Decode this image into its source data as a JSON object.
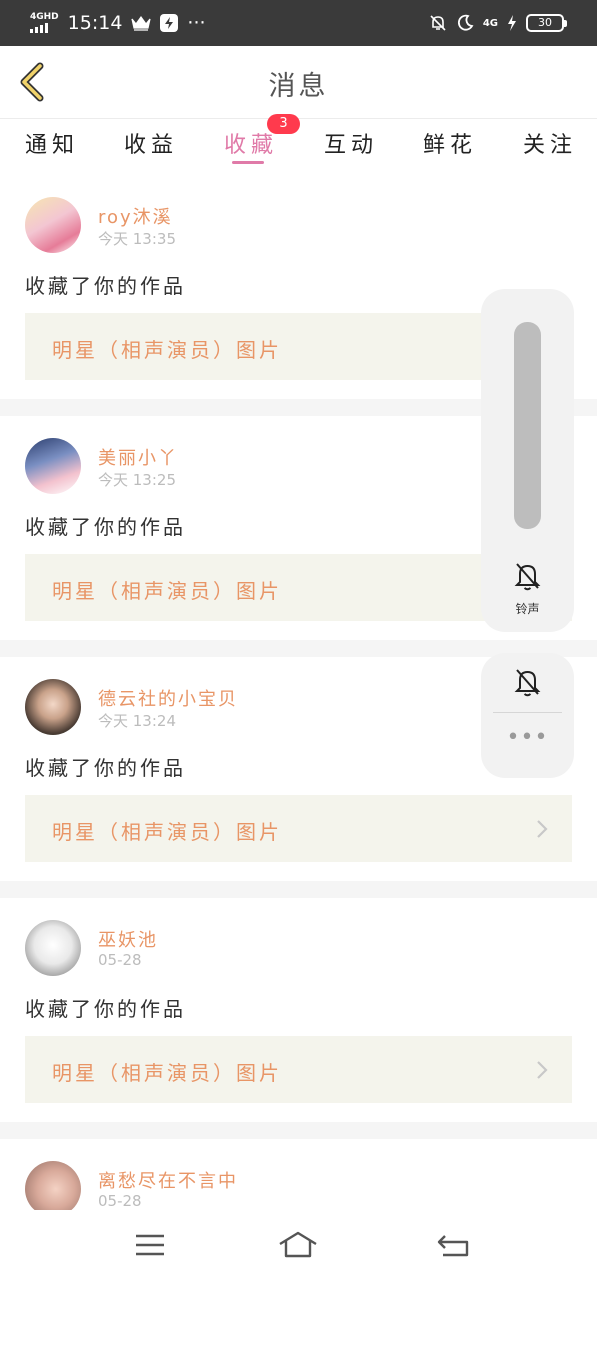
{
  "status_bar": {
    "network": "4GHD",
    "time": "15:14",
    "more": "···",
    "net2": "4G",
    "battery": "30"
  },
  "header": {
    "title": "消息"
  },
  "tabs": [
    {
      "label": "通知"
    },
    {
      "label": "收益"
    },
    {
      "label": "收藏",
      "active": true,
      "badge": "3"
    },
    {
      "label": "互动"
    },
    {
      "label": "鲜花"
    },
    {
      "label": "关注"
    }
  ],
  "items": [
    {
      "user": "roy沐溪",
      "time": "今天 13:35",
      "action": "收藏了你的作品",
      "work": "明星（相声演员）图片"
    },
    {
      "user": "美丽小丫",
      "time": "今天 13:25",
      "action": "收藏了你的作品",
      "work": "明星（相声演员）图片"
    },
    {
      "user": "德云社的小宝贝",
      "time": "今天 13:24",
      "action": "收藏了你的作品",
      "work": "明星（相声演员）图片"
    },
    {
      "user": "巫妖池",
      "time": "05-28",
      "action": "收藏了你的作品",
      "work": "明星（相声演员）图片"
    },
    {
      "user": "离愁尽在不言中",
      "time": "05-28"
    }
  ],
  "ringer_panel": {
    "label": "铃声",
    "more": "•••"
  },
  "colors": {
    "accent": "#e07aa8",
    "username": "#e89566",
    "badge": "#ff3a4d",
    "work_bg": "#f4f4ec"
  }
}
